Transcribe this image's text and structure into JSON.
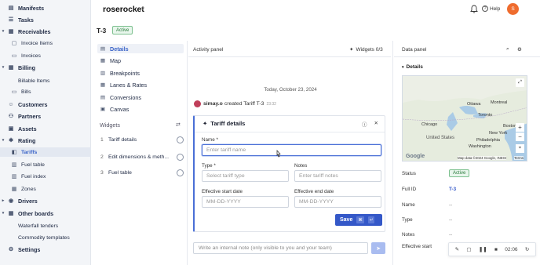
{
  "sidebar": {
    "items": [
      {
        "label": "Manifests",
        "icon": "manifest-icon",
        "level": "top",
        "caret": ""
      },
      {
        "label": "Tasks",
        "icon": "tasks-icon",
        "level": "top",
        "caret": ""
      },
      {
        "label": "Receivables",
        "icon": "receivables-icon",
        "level": "top",
        "caret": "▾"
      },
      {
        "label": "Invoice Items",
        "icon": "invoice-items-icon",
        "level": "sub",
        "caret": ""
      },
      {
        "label": "Invoices",
        "icon": "invoices-icon",
        "level": "sub",
        "caret": ""
      },
      {
        "label": "Billing",
        "icon": "billing-icon",
        "level": "top",
        "caret": "▾"
      },
      {
        "label": "Billable Items",
        "icon": "",
        "level": "sub",
        "caret": ""
      },
      {
        "label": "Bills",
        "icon": "bills-icon",
        "level": "sub",
        "caret": ""
      },
      {
        "label": "Customers",
        "icon": "customers-icon",
        "level": "top",
        "caret": ""
      },
      {
        "label": "Partners",
        "icon": "partners-icon",
        "level": "top",
        "caret": ""
      },
      {
        "label": "Assets",
        "icon": "assets-icon",
        "level": "top",
        "caret": ""
      },
      {
        "label": "Rating",
        "icon": "rating-icon",
        "level": "top",
        "caret": "▾"
      },
      {
        "label": "Tariffs",
        "icon": "tariffs-icon",
        "level": "sub",
        "caret": "",
        "active": true
      },
      {
        "label": "Fuel table",
        "icon": "fuel-table-icon",
        "level": "sub",
        "caret": ""
      },
      {
        "label": "Fuel index",
        "icon": "fuel-index-icon",
        "level": "sub",
        "caret": ""
      },
      {
        "label": "Zones",
        "icon": "zones-icon",
        "level": "sub",
        "caret": ""
      },
      {
        "label": "Drivers",
        "icon": "drivers-icon",
        "level": "top",
        "caret": "▸"
      },
      {
        "label": "Other boards",
        "icon": "other-boards-icon",
        "level": "top",
        "caret": "▾"
      },
      {
        "label": "Waterfall tenders",
        "icon": "",
        "level": "sub",
        "caret": ""
      },
      {
        "label": "Commodity templates",
        "icon": "",
        "level": "sub",
        "caret": ""
      },
      {
        "label": "Settings",
        "icon": "settings-icon",
        "level": "top",
        "caret": ""
      }
    ]
  },
  "header": {
    "brand": "roserocket",
    "help_label": "Help",
    "avatar_initial": "S"
  },
  "page": {
    "title": "T-3",
    "status": "Active"
  },
  "subnav": {
    "items": [
      {
        "label": "Details",
        "icon": "details-icon",
        "active": true
      },
      {
        "label": "Map",
        "icon": "map-icon"
      },
      {
        "label": "Breakpoints",
        "icon": "breakpoints-icon"
      },
      {
        "label": "Lanes & Rates",
        "icon": "lanes-icon"
      },
      {
        "label": "Conversions",
        "icon": "conversions-icon"
      },
      {
        "label": "Canvas",
        "icon": "canvas-icon"
      }
    ],
    "widgets_title": "Widgets",
    "widgets": [
      {
        "num": "1",
        "label": "Tariff details"
      },
      {
        "num": "2",
        "label": "Edit dimensions & meth..."
      },
      {
        "num": "3",
        "label": "Fuel table"
      }
    ]
  },
  "activity": {
    "title": "Activity panel",
    "widgets_label": "Widgets 0/3",
    "date": "Today, October 23, 2024",
    "log_user": "simay.o",
    "log_text": "created Tariff T-3",
    "log_time": "23:32",
    "note_placeholder": "Write an internal note (only visible to you and your team)"
  },
  "tariff_card": {
    "title": "Tariff details",
    "name_label": "Name *",
    "name_placeholder": "Enter tariff name",
    "type_label": "Type *",
    "type_placeholder": "Select tariff type",
    "notes_label": "Notes",
    "notes_placeholder": "Enter tariff notes",
    "start_label": "Effective start date",
    "start_placeholder": "MM-DD-YYYY",
    "end_label": "Effective end date",
    "end_placeholder": "MM-DD-YYYY",
    "save_label": "Save"
  },
  "data_panel": {
    "title": "Data panel",
    "section": "Details",
    "map_labels": [
      "Ottawa",
      "Montreal",
      "Toronto",
      "Boston",
      "Chicago",
      "New York",
      "Philadelphia",
      "Washington",
      "United States"
    ],
    "map_attribution": "Map data ©2024 Google, INEGI",
    "map_terms": "Terms",
    "google_logo": "Google",
    "fields": [
      {
        "label": "Status",
        "value": "Active"
      },
      {
        "label": "Full ID",
        "value": "T-3"
      },
      {
        "label": "Name",
        "value": "--"
      },
      {
        "label": "Type",
        "value": "--"
      },
      {
        "label": "Notes",
        "value": "--"
      },
      {
        "label": "Effective start",
        "value": ""
      }
    ]
  },
  "player": {
    "time": "02:06"
  },
  "colors": {
    "accent": "#3458c8",
    "active_green": "#2a7a3c",
    "avatar": "#ef6c2e"
  }
}
